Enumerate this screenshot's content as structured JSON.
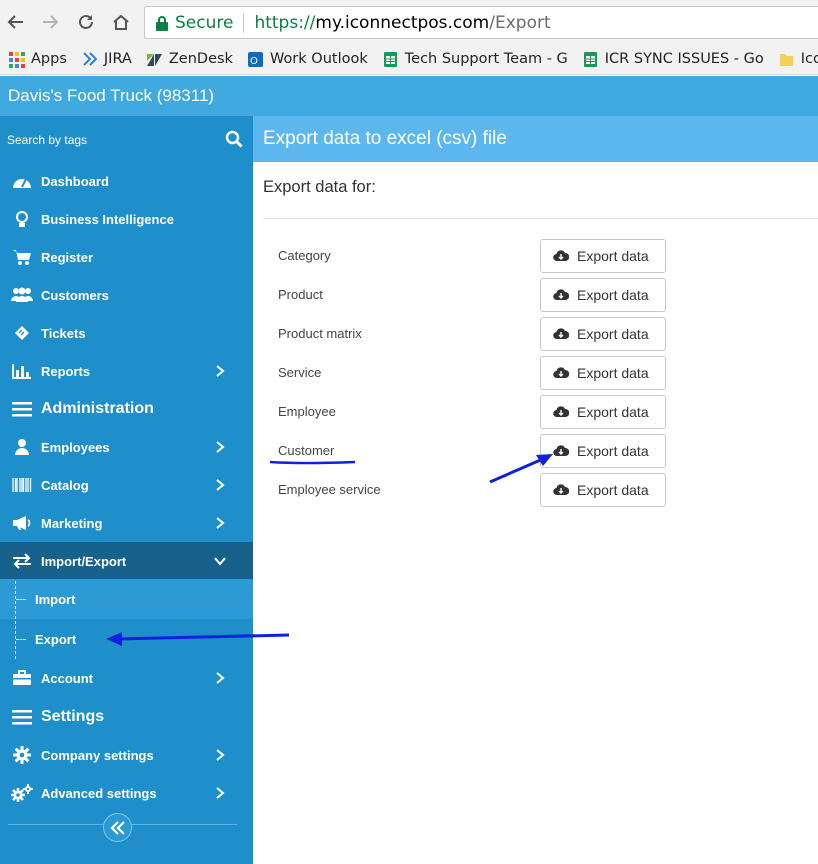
{
  "browser": {
    "secure_label": "Secure",
    "url_proto": "https://",
    "url_host": "my.iconnectpos.com",
    "url_path": "/Export",
    "bookmarks": [
      {
        "label": "Apps"
      },
      {
        "label": "JIRA"
      },
      {
        "label": "ZenDesk"
      },
      {
        "label": "Work Outlook"
      },
      {
        "label": "Tech Support Team - G"
      },
      {
        "label": "ICR SYNC ISSUES - Go"
      },
      {
        "label": "Iconn"
      }
    ]
  },
  "header": {
    "title": "Davis's Food Truck (98311)"
  },
  "sidebar": {
    "search_placeholder": "Search by tags",
    "items": [
      {
        "label": "Dashboard"
      },
      {
        "label": "Business Intelligence"
      },
      {
        "label": "Register"
      },
      {
        "label": "Customers"
      },
      {
        "label": "Tickets"
      },
      {
        "label": "Reports"
      },
      {
        "label": "Administration"
      },
      {
        "label": "Employees"
      },
      {
        "label": "Catalog"
      },
      {
        "label": "Marketing"
      },
      {
        "label": "Import/Export"
      },
      {
        "label": "Import"
      },
      {
        "label": "Export"
      },
      {
        "label": "Account"
      },
      {
        "label": "Settings"
      },
      {
        "label": "Company settings"
      },
      {
        "label": "Advanced settings"
      }
    ]
  },
  "main": {
    "title": "Export data to excel (csv) file",
    "subtitle": "Export data for:",
    "button_label": "Export data",
    "rows": [
      {
        "label": "Category"
      },
      {
        "label": "Product"
      },
      {
        "label": "Product matrix"
      },
      {
        "label": "Service"
      },
      {
        "label": "Employee"
      },
      {
        "label": "Customer"
      },
      {
        "label": "Employee service"
      }
    ]
  },
  "colors": {
    "header_bg": "#3fa9e0",
    "sidebar_bg": "#1e8fcb",
    "sidebar_active": "#16628d",
    "panel_header_bg": "#5cb7ee",
    "annotation": "#1020e0"
  }
}
